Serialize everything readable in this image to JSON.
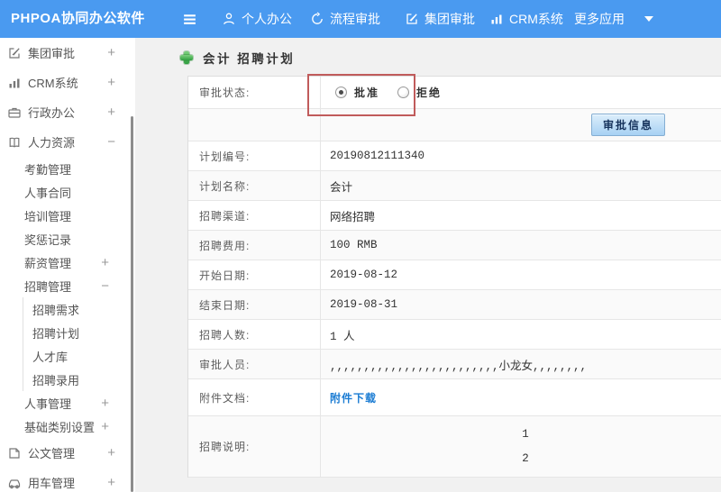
{
  "navbar": {
    "logo": "PHPOA协同办公软件",
    "items": [
      {
        "label": "个人办公",
        "icon": "user-icon"
      },
      {
        "label": "流程审批",
        "icon": "history-icon"
      },
      {
        "label": "集团审批",
        "icon": "edit-icon"
      },
      {
        "label": "CRM系统",
        "icon": "chart-icon"
      },
      {
        "label": "更多应用",
        "icon": "caret-down-icon"
      }
    ]
  },
  "sidebar": {
    "items": [
      {
        "label": "集团审批",
        "icon": "edit-icon",
        "expand": "+"
      },
      {
        "label": "CRM系统",
        "icon": "chart-icon",
        "expand": "+"
      },
      {
        "label": "行政办公",
        "icon": "briefcase-icon",
        "expand": "+"
      },
      {
        "label": "人力资源",
        "icon": "book-icon",
        "expand": "−"
      },
      {
        "label": "考勤管理"
      },
      {
        "label": "人事合同"
      },
      {
        "label": "培训管理"
      },
      {
        "label": "奖惩记录"
      },
      {
        "label": "薪资管理",
        "expand": "+"
      },
      {
        "label": "招聘管理",
        "expand": "−"
      },
      {
        "label": "招聘需求"
      },
      {
        "label": "招聘计划"
      },
      {
        "label": "人才库"
      },
      {
        "label": "招聘录用"
      },
      {
        "label": "人事管理",
        "expand": "+"
      },
      {
        "label": "基础类别设置",
        "expand": "+"
      },
      {
        "label": "公文管理",
        "icon": "document-icon",
        "expand": "+"
      },
      {
        "label": "用车管理",
        "icon": "car-icon",
        "expand": "+"
      }
    ]
  },
  "page": {
    "title": "会计 招聘计划"
  },
  "form": {
    "status_label": "审批状态:",
    "radio_approve": "批准",
    "radio_reject": "拒绝",
    "approve_selected": true,
    "reject_selected": false,
    "approve_button": "审批信息",
    "rows": [
      {
        "label": "计划编号:",
        "value": "20190812111340"
      },
      {
        "label": "计划名称:",
        "value": "会计"
      },
      {
        "label": "招聘渠道:",
        "value": "网络招聘"
      },
      {
        "label": "招聘费用:",
        "value": "100 RMB"
      },
      {
        "label": "开始日期:",
        "value": "2019-08-12"
      },
      {
        "label": "结束日期:",
        "value": "2019-08-31"
      },
      {
        "label": "招聘人数:",
        "value": "1 人"
      },
      {
        "label": "审批人员:",
        "value": ",,,,,,,,,,,,,,,,,,,,,,,,,小龙女,,,,,,,,"
      }
    ],
    "attachment_label": "附件文档:",
    "attachment_link": "附件下载",
    "description_label": "招聘说明:",
    "description_lines": [
      "1",
      "2"
    ]
  },
  "colors": {
    "navbar_blue": "#4a9af0",
    "annotation_red": "#c05b5b",
    "link_blue": "#1b7cd3",
    "button_top": "#dceefb",
    "button_bottom": "#a7d1f3",
    "plus_green": "#2f9e3f"
  }
}
